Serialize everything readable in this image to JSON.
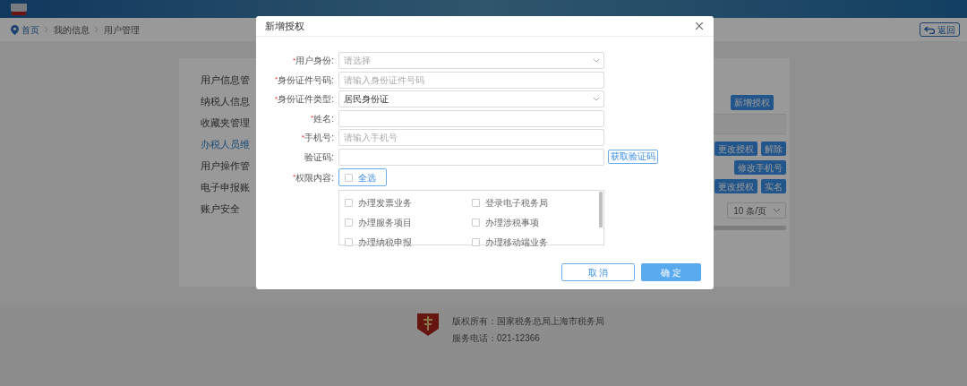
{
  "breadcrumb": {
    "items": [
      {
        "label": "首页",
        "link": true
      },
      {
        "label": "我的信息",
        "link": false
      },
      {
        "label": "用户管理",
        "link": false
      }
    ],
    "back_button": "返回"
  },
  "sidebar": {
    "items": [
      {
        "label": "用户信息管",
        "selected": false
      },
      {
        "label": "纳税人信息",
        "selected": false
      },
      {
        "label": "收藏夹管理",
        "selected": false
      },
      {
        "label": "办税人员维",
        "selected": true
      },
      {
        "label": "用户操作管",
        "selected": false
      },
      {
        "label": "电子申报账",
        "selected": false
      },
      {
        "label": "账户安全",
        "selected": false
      }
    ]
  },
  "panel": {
    "add_button": "新增授权",
    "rows": [
      [
        "更改授权",
        "解除"
      ],
      [
        "修改手机号"
      ],
      [
        "更改授权",
        "实名"
      ]
    ],
    "page_size": "10 条/页"
  },
  "footer": {
    "lines": [
      "版权所有：国家税务总局上海市税务局",
      "服务电话：021-12366"
    ]
  },
  "dialog": {
    "title": "新增授权",
    "fields": [
      {
        "kind": "select",
        "mark": "*",
        "label": "用户身份:",
        "placeholder": "请选择"
      },
      {
        "kind": "input",
        "mark": "*",
        "label": "身份证件号码:",
        "placeholder": "请输入身份证件号码"
      },
      {
        "kind": "select",
        "mark": "*",
        "label": "身份证件类型:",
        "value": "居民身份证"
      },
      {
        "kind": "input",
        "mark": "*",
        "label": "姓名:"
      },
      {
        "kind": "input",
        "mark": "*",
        "label": "手机号:",
        "placeholder": "请输入手机号"
      },
      {
        "kind": "code",
        "label": "验证码:",
        "button": "获取验证码"
      }
    ],
    "permissions": {
      "mark": "*",
      "label": "权限内容:",
      "select_all": {
        "label": "全选",
        "checked": false
      },
      "items": [
        {
          "label": "办理发票业务",
          "checked": false
        },
        {
          "label": "登录电子税务局",
          "checked": false
        },
        {
          "label": "办理服务项目",
          "checked": false
        },
        {
          "label": "办理涉税事项",
          "checked": false
        },
        {
          "label": "办理纳税申报",
          "checked": false
        },
        {
          "label": "办理移动端业务",
          "checked": false
        }
      ]
    },
    "buttons": [
      {
        "kind": "secondary",
        "label": "取 消"
      },
      {
        "kind": "primary",
        "label": "确 定"
      }
    ]
  }
}
